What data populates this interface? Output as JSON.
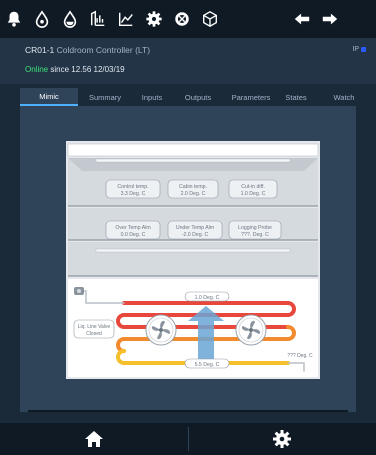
{
  "toolbar": {
    "icons": [
      "bell-icon",
      "drop-icon",
      "drop-filled-icon",
      "report-icon",
      "chart-icon",
      "gear-icon",
      "compass-icon",
      "cube-icon",
      "back-arrow-icon",
      "forward-arrow-icon"
    ]
  },
  "header": {
    "device_id": "CR01-1",
    "device_name": "Coldroom Controller (LT)",
    "ip_label": "IP",
    "status_online": "Online",
    "status_since": " since 12.56 12/03/19"
  },
  "tabs": [
    "Mimic",
    "Summary",
    "Inputs",
    "Outputs",
    "Parameters",
    "States",
    "Watch"
  ],
  "active_tab": "Mimic",
  "mimic": {
    "row1": [
      {
        "label": "Control temp.",
        "value": "3.3 Deg. C"
      },
      {
        "label": "Cabin temp.",
        "value": "2.0 Deg. C"
      },
      {
        "label": "Cut-in diff.",
        "value": "1.0 Deg. C"
      }
    ],
    "row2": [
      {
        "label": "Over Temp Alm",
        "value": "0.0 Deg. C"
      },
      {
        "label": "Under Temp Alm",
        "value": "-2.0 Deg. C"
      },
      {
        "label": "Logging Probe",
        "value": "???. Deg. C"
      }
    ],
    "valve_line1": "Liq. Line Valve",
    "valve_line2": "Closed",
    "top_pipe_temp": "1.0 Deg. C",
    "bottom_pipe_temp": "5.5 Deg. C",
    "outlet_temp": "??? Deg. C"
  },
  "colors": {
    "accent": "#4fb0ff",
    "online": "#3fe07a",
    "pipe_red": "#e8483c",
    "pipe_orange": "#f28b2e",
    "pipe_yellow": "#f5c02a",
    "arrow_blue": "#6aa6d6"
  },
  "bottom": {
    "left_icon": "home-icon",
    "right_icon": "gear-icon"
  }
}
